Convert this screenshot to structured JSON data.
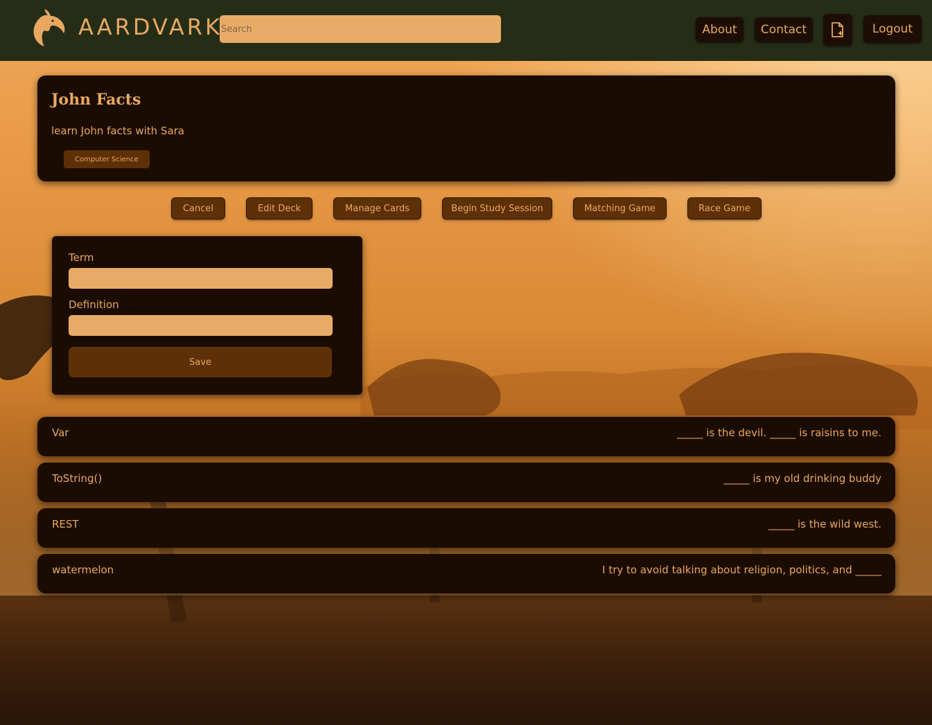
{
  "header": {
    "brand": "AARDVARK",
    "search_placeholder": "Search",
    "nav": {
      "about": "About",
      "contact": "Contact",
      "logout": "Logout"
    }
  },
  "deck": {
    "title": "John Facts",
    "description": "learn John facts with Sara",
    "tag": "Computer Science"
  },
  "actions": {
    "cancel": "Cancel",
    "edit_deck": "Edit Deck",
    "manage_cards": "Manage Cards",
    "begin_study": "Begin Study Session",
    "matching_game": "Matching Game",
    "race_game": "Race Game"
  },
  "form": {
    "term_label": "Term",
    "definition_label": "Definition",
    "save_label": "Save"
  },
  "cards": [
    {
      "term": "Var",
      "definition": "_____ is the devil. _____ is raisins to me."
    },
    {
      "term": "ToString()",
      "definition": "_____ is my old drinking buddy"
    },
    {
      "term": "REST",
      "definition": "_____ is the wild west."
    },
    {
      "term": "watermelon",
      "definition": "I try to avoid talking about religion, politics, and _____"
    }
  ]
}
